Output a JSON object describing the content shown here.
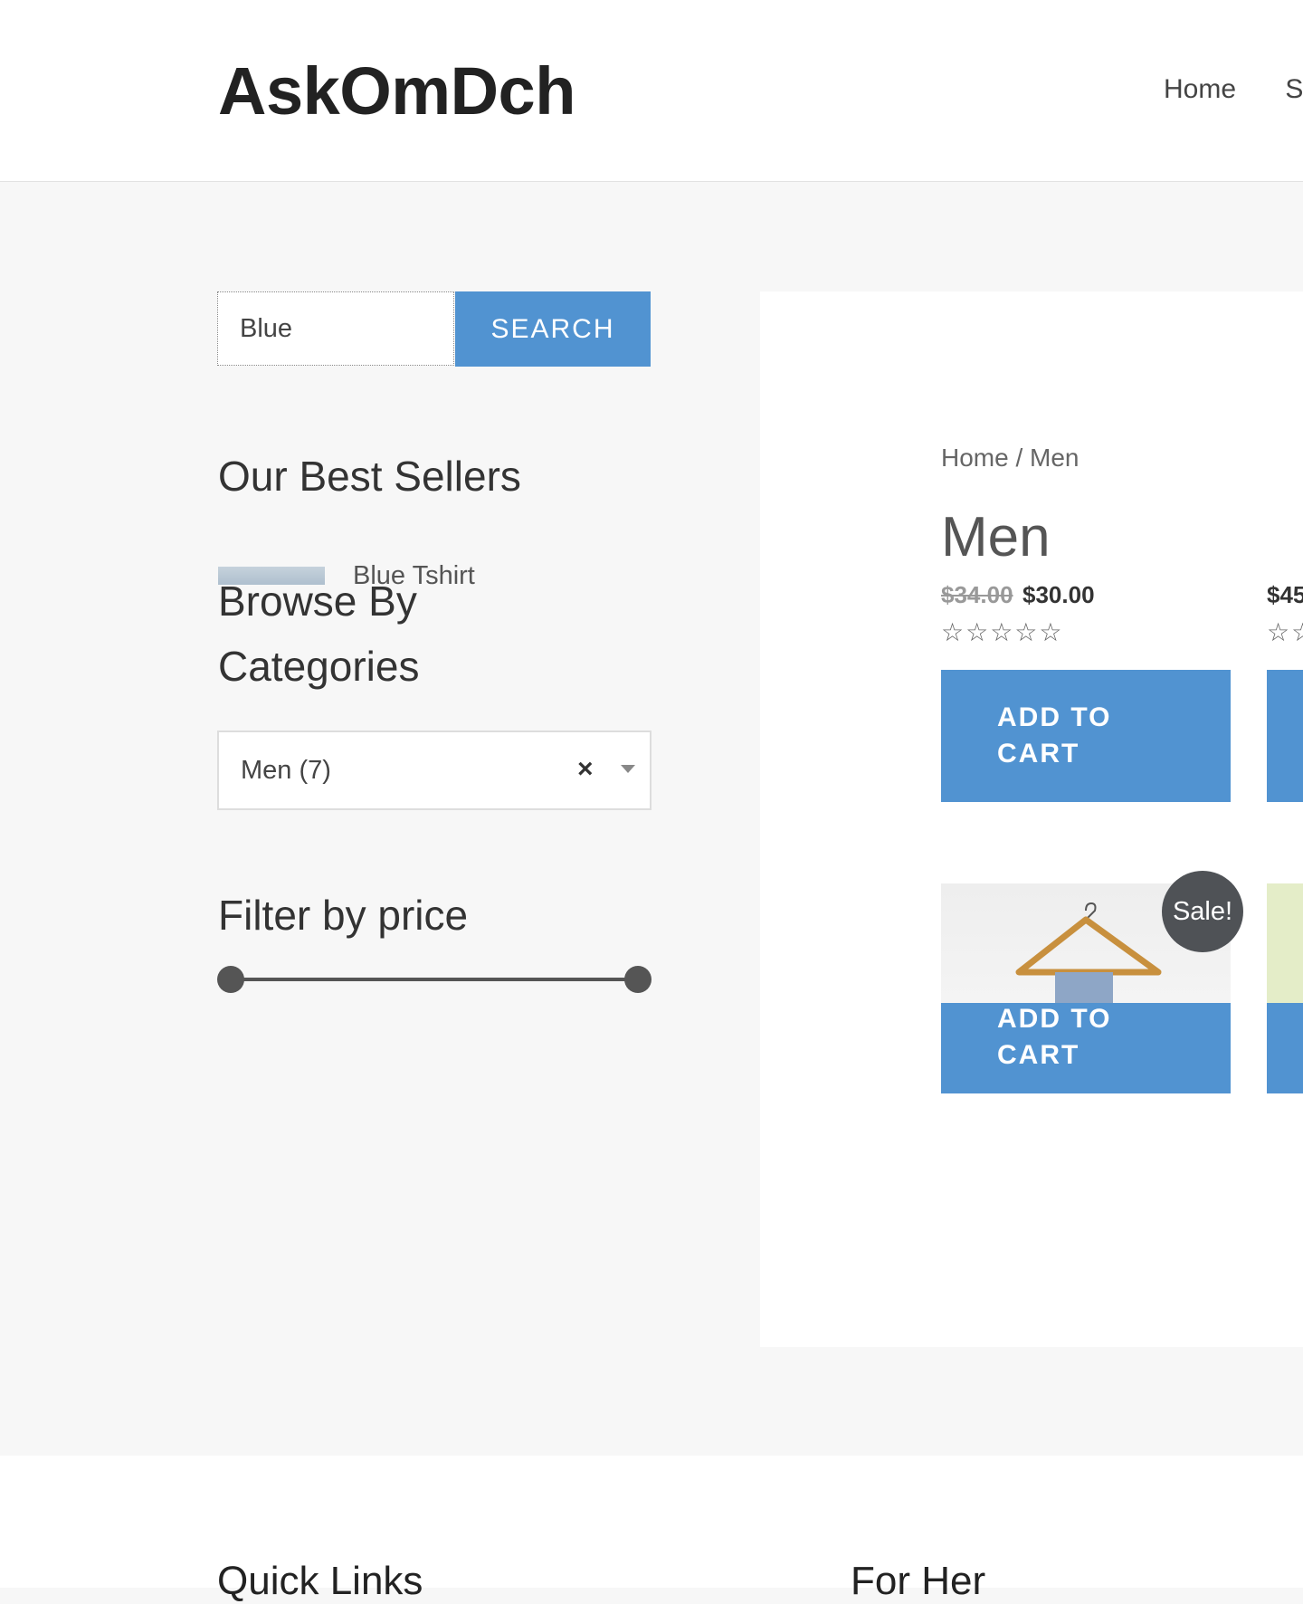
{
  "header": {
    "logo": "AskOmDch",
    "nav": [
      "Home",
      "S"
    ]
  },
  "sidebar": {
    "search": {
      "value": "Blue",
      "button": "SEARCH"
    },
    "best_sellers": {
      "title": "Our Best Sellers",
      "items": [
        {
          "name": "Blue Tshirt"
        }
      ]
    },
    "categories": {
      "title_line1": "Browse By",
      "title_line2": "Categories",
      "selected": "Men  (7)",
      "clear": "×"
    },
    "price_filter": {
      "title": "Filter by price",
      "range_low_fraction": 0,
      "range_high_fraction": 1
    }
  },
  "main": {
    "breadcrumb": "Home / Men",
    "title": "Men",
    "products": [
      {
        "old_price": "$34.00",
        "price": "$30.00",
        "rating": 0,
        "stars": "☆☆☆☆☆",
        "button_line1": "ADD TO",
        "button_line2": "CART"
      },
      {
        "price": "$45",
        "stars": "☆☆"
      },
      {
        "sale_badge": "Sale!",
        "button_line1": "ADD TO",
        "button_line2": "CART"
      }
    ]
  },
  "footer": {
    "columns": [
      "Quick Links",
      "For Her"
    ]
  },
  "colors": {
    "accent": "#5193d1",
    "badge": "#4f5256",
    "background": "#f7f7f7"
  }
}
